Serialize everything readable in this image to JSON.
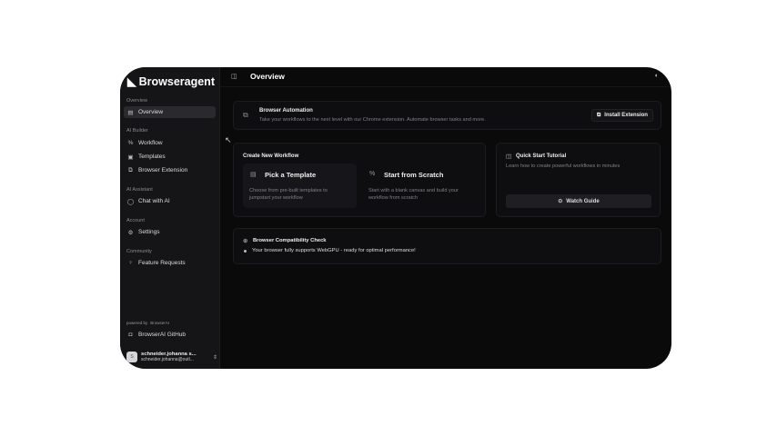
{
  "sidebar": {
    "brand": "Browseragent",
    "sections": [
      {
        "label": "Overview",
        "items": [
          {
            "label": "Overview",
            "icon": "file-icon",
            "active": true
          }
        ]
      },
      {
        "label": "AI Builder",
        "items": [
          {
            "label": "Workflow",
            "icon": "workflow-icon"
          },
          {
            "label": "Templates",
            "icon": "template-icon"
          },
          {
            "label": "Browser Extension",
            "icon": "extension-icon"
          }
        ]
      },
      {
        "label": "AI Assistant",
        "items": [
          {
            "label": "Chat with AI",
            "icon": "chat-icon"
          }
        ]
      },
      {
        "label": "Account",
        "items": [
          {
            "label": "Settings",
            "icon": "gear-icon"
          }
        ]
      },
      {
        "label": "Community",
        "items": [
          {
            "label": "Feature Requests",
            "icon": "lightbulb-icon"
          }
        ]
      }
    ],
    "powered_by": "powered by",
    "powered_brand": "BrowserAI",
    "github": "BrowserAI GitHub",
    "user": {
      "avatar": "S",
      "name": "schneider.johanna s...",
      "email": "schneider.johanna@outl..."
    }
  },
  "header": {
    "title": "Overview"
  },
  "banner": {
    "title": "Browser Automation",
    "desc": "Take your workflows to the next level with our Chrome extension. Automate browser tasks and more.",
    "button": "Install Extension"
  },
  "create": {
    "title": "Create New Workflow",
    "options": [
      {
        "title": "Pick a Template",
        "desc": "Choose from pre-built templates to jumpstart your workflow"
      },
      {
        "title": "Start from Scratch",
        "desc": "Start with a blank canvas and build your workflow from scratch"
      }
    ]
  },
  "tutorial": {
    "title": "Quick Start Tutorial",
    "desc": "Learn how to create powerful workflows in minutes",
    "button": "Watch Guide"
  },
  "compat": {
    "title": "Browser Compatibility Check",
    "message": "Your browser fully supports WebGPU - ready for optimal performance!"
  }
}
